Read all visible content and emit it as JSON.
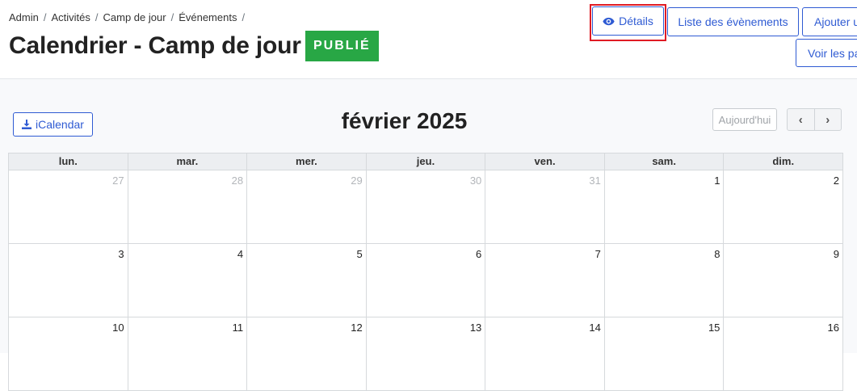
{
  "breadcrumb": [
    "Admin",
    "Activités",
    "Camp de jour",
    "Événements"
  ],
  "breadcrumb_separator": "/",
  "page_title": "Calendrier - Camp de jour",
  "status_badge": {
    "label": "PUBLIÉ",
    "color": "#28a745"
  },
  "actions": {
    "details": "Détails",
    "event_list": "Liste des évènements",
    "add": "Ajouter u",
    "view": "Voir les pa"
  },
  "calendar": {
    "export_label": "iCalendar",
    "month_title": "février 2025",
    "today_label": "Aujourd'hui",
    "prev_icon": "‹",
    "next_icon": "›",
    "weekdays": [
      "lun.",
      "mar.",
      "mer.",
      "jeu.",
      "ven.",
      "sam.",
      "dim."
    ],
    "weeks": [
      [
        {
          "day": "27",
          "other": true
        },
        {
          "day": "28",
          "other": true
        },
        {
          "day": "29",
          "other": true
        },
        {
          "day": "30",
          "other": true
        },
        {
          "day": "31",
          "other": true
        },
        {
          "day": "1",
          "other": false
        },
        {
          "day": "2",
          "other": false
        }
      ],
      [
        {
          "day": "3",
          "other": false
        },
        {
          "day": "4",
          "other": false
        },
        {
          "day": "5",
          "other": false
        },
        {
          "day": "6",
          "other": false
        },
        {
          "day": "7",
          "other": false
        },
        {
          "day": "8",
          "other": false
        },
        {
          "day": "9",
          "other": false
        }
      ],
      [
        {
          "day": "10",
          "other": false
        },
        {
          "day": "11",
          "other": false
        },
        {
          "day": "12",
          "other": false
        },
        {
          "day": "13",
          "other": false
        },
        {
          "day": "14",
          "other": false
        },
        {
          "day": "15",
          "other": false
        },
        {
          "day": "16",
          "other": false
        }
      ]
    ]
  },
  "colors": {
    "primary": "#2f5bd3",
    "highlight": "#e01b24",
    "published": "#28a745"
  }
}
